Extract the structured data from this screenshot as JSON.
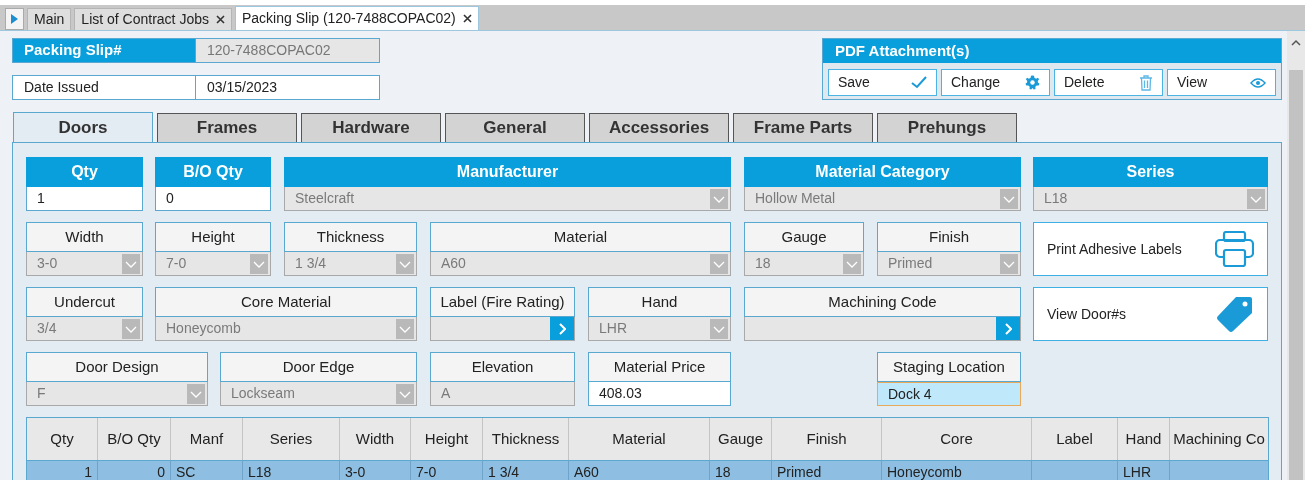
{
  "document_tabs": [
    {
      "label": "Main",
      "selected": false,
      "closable": false
    },
    {
      "label": "List of Contract Jobs",
      "selected": false,
      "closable": true
    },
    {
      "label": "Packing Slip (120-7488COPAC02)",
      "selected": true,
      "closable": true
    }
  ],
  "header_fields": [
    {
      "label": "Packing Slip#",
      "value": "120-7488COPAC02",
      "readonly": true
    },
    {
      "label": "Date Issued",
      "value": "03/15/2023",
      "readonly": false
    }
  ],
  "pdf_attachments": {
    "title": "PDF Attachment(s)",
    "buttons": [
      {
        "label": "Save",
        "kind": "save"
      },
      {
        "label": "Change",
        "kind": "change"
      },
      {
        "label": "Delete",
        "kind": "delete"
      },
      {
        "label": "View",
        "kind": "view"
      }
    ]
  },
  "section_tabs": [
    {
      "label": "Doors",
      "selected": true
    },
    {
      "label": "Frames",
      "selected": false
    },
    {
      "label": "Hardware",
      "selected": false
    },
    {
      "label": "General",
      "selected": false
    },
    {
      "label": "Accessories",
      "selected": false
    },
    {
      "label": "Frame Parts",
      "selected": false
    },
    {
      "label": "Prehungs",
      "selected": false
    }
  ],
  "form_rows": [
    [
      {
        "label": "Qty",
        "kind": "input",
        "value": "1",
        "highlighted": true,
        "focused": false
      },
      {
        "label": "B/O Qty",
        "kind": "input",
        "value": "0",
        "highlighted": true,
        "focused": false
      },
      {
        "label": "Manufacturer",
        "kind": "select",
        "value": "Steelcraft",
        "highlighted": true
      },
      {
        "label": "Material Category",
        "kind": "select",
        "value": "Hollow Metal",
        "highlighted": true
      },
      {
        "label": "Series",
        "kind": "select",
        "value": "L18",
        "highlighted": true
      }
    ],
    [
      {
        "label": "Width",
        "kind": "select",
        "value": "3-0",
        "highlighted": false
      },
      {
        "label": "Height",
        "kind": "select",
        "value": "7-0",
        "highlighted": false
      },
      {
        "label": "Thickness",
        "kind": "select",
        "value": "1 3/4",
        "highlighted": false
      },
      {
        "label": "Material",
        "kind": "select",
        "value": "A60",
        "highlighted": false
      },
      {
        "label": "Gauge",
        "kind": "select",
        "value": "18",
        "highlighted": false
      },
      {
        "label": "Finish",
        "kind": "select",
        "value": "Primed",
        "highlighted": false
      },
      {
        "label": "Print Adhesive Labels",
        "kind": "print_action"
      }
    ],
    [
      {
        "label": "Undercut",
        "kind": "select",
        "value": "3/4",
        "highlighted": false
      },
      {
        "label": "Core Material",
        "kind": "select",
        "value": "Honeycomb",
        "highlighted": false
      },
      {
        "label": "Label (Fire Rating)",
        "kind": "picker",
        "highlighted": false
      },
      {
        "label": "Hand",
        "kind": "select",
        "value": "LHR",
        "highlighted": false
      },
      {
        "label": "Machining Code",
        "kind": "picker",
        "highlighted": false
      },
      {
        "label": "View Door#s",
        "kind": "tag_action"
      }
    ],
    [
      {
        "label": "Door Design",
        "kind": "select",
        "value": "F",
        "highlighted": false
      },
      {
        "label": "Door Edge",
        "kind": "select",
        "value": "Lockseam",
        "highlighted": false
      },
      {
        "label": "Elevation",
        "kind": "readonly",
        "value": "A",
        "highlighted": false
      },
      {
        "label": "Material Price",
        "kind": "input",
        "value": "408.03",
        "highlighted": false,
        "focused": false
      },
      {
        "label": "Staging Location",
        "kind": "input",
        "value": "Dock 4",
        "highlighted": false,
        "focused": true
      }
    ]
  ],
  "table": {
    "columns": [
      "Qty",
      "B/O Qty",
      "Manf",
      "Series",
      "Width",
      "Height",
      "Thickness",
      "Material",
      "Gauge",
      "Finish",
      "Core",
      "Label",
      "Hand",
      "Machining Co"
    ],
    "rows": [
      {
        "selected": true,
        "cells": [
          "1",
          "0",
          "SC",
          "L18",
          "3-0",
          "7-0",
          "1 3/4",
          "A60",
          "18",
          "Primed",
          "Honeycomb",
          null,
          "LHR",
          null
        ]
      }
    ]
  }
}
